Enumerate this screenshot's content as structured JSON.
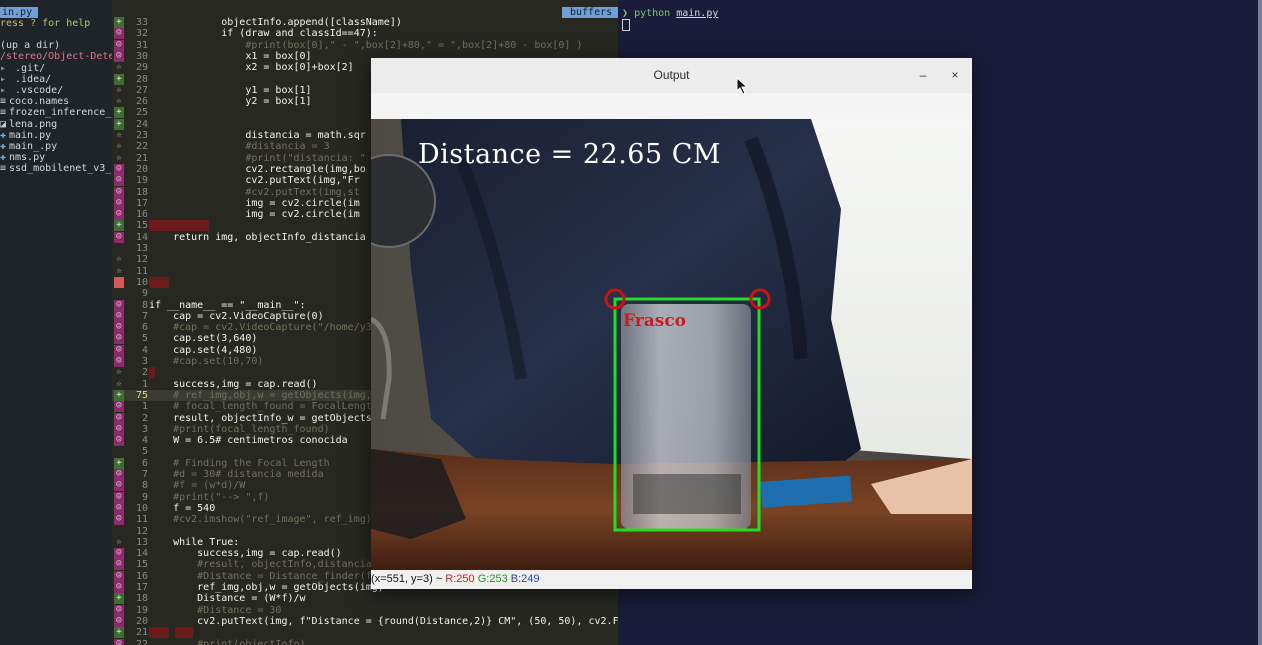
{
  "file_tree": {
    "tab": "in.py",
    "help": "ress ? for help",
    "entries": [
      {
        "icon": "",
        "text": ""
      },
      {
        "icon": "",
        "text": "(up a dir)"
      },
      {
        "icon": "",
        "text": "/stereo/Object-Dete"
      },
      {
        "icon": "folder",
        "text": " .git/"
      },
      {
        "icon": "folder",
        "text": " .idea/"
      },
      {
        "icon": "folder",
        "text": " .vscode/"
      },
      {
        "icon": "file",
        "text": "coco.names"
      },
      {
        "icon": "file",
        "text": "frozen_inference_"
      },
      {
        "icon": "image",
        "text": "lena.png"
      },
      {
        "icon": "python",
        "text": "main.py"
      },
      {
        "icon": "python",
        "text": "main_.py"
      },
      {
        "icon": "python",
        "text": "nms.py"
      },
      {
        "icon": "file",
        "text": "ssd_mobilenet_v3_"
      }
    ]
  },
  "editor": {
    "lines": [
      {
        "sign": "+",
        "num": "33",
        "code": "            objectInfo.append([className])"
      },
      {
        "sign": "demon",
        "num": "32",
        "code": "            if (draw and classId==47):"
      },
      {
        "sign": "demon",
        "num": "31",
        "code": "                #print(box[0],\" - \",box[2]+80,\" = \",box[2]+80 - box[0] )"
      },
      {
        "sign": "demon",
        "num": "30",
        "code": "                x1 = box[0]"
      },
      {
        "sign": "star",
        "num": "29",
        "code": "                x2 = box[0]+box[2]"
      },
      {
        "sign": "+",
        "num": "28",
        "code": ""
      },
      {
        "sign": "star",
        "num": "27",
        "code": "                y1 = box[1]"
      },
      {
        "sign": "star",
        "num": "26",
        "code": "                y2 = box[1]"
      },
      {
        "sign": "+",
        "num": "25",
        "code": ""
      },
      {
        "sign": "+",
        "num": "24",
        "code": ""
      },
      {
        "sign": "star",
        "num": "23",
        "code": "                distancia = math.sqr"
      },
      {
        "sign": "star",
        "num": "22",
        "code": "                #distancia = 3"
      },
      {
        "sign": "star",
        "num": "21",
        "code": "                #print(\"distancia: \""
      },
      {
        "sign": "demon",
        "num": "20",
        "code": "                cv2.rectangle(img,bo"
      },
      {
        "sign": "demon",
        "num": "19",
        "code": "                cv2.putText(img,\"Fr"
      },
      {
        "sign": "demon",
        "num": "18",
        "code": "                #cv2.putText(img,st"
      },
      {
        "sign": "demon",
        "num": "17",
        "code": "                img = cv2.circle(im"
      },
      {
        "sign": "demon",
        "num": "16",
        "code": "                img = cv2.circle(im"
      },
      {
        "sign": "+",
        "num": "15",
        "code": ""
      },
      {
        "sign": "demon",
        "num": "14",
        "code": "    return img, objectInfo_distancia"
      },
      {
        "sign": "",
        "num": "13",
        "code": ""
      },
      {
        "sign": "star",
        "num": "12",
        "code": ""
      },
      {
        "sign": "star",
        "num": "11",
        "code": ""
      },
      {
        "sign": "red",
        "num": "10",
        "code": ""
      },
      {
        "sign": "",
        "num": "9",
        "code": ""
      },
      {
        "sign": "demon",
        "num": "8",
        "code": "if __name__ == \"__main__\":"
      },
      {
        "sign": "demon",
        "num": "7",
        "code": "    cap = cv2.VideoCapture(0)"
      },
      {
        "sign": "demon",
        "num": "6",
        "code": "    #cap = cv2.VideoCapture(\"/home/y3rs"
      },
      {
        "sign": "demon",
        "num": "5",
        "code": "    cap.set(3,640)"
      },
      {
        "sign": "demon",
        "num": "4",
        "code": "    cap.set(4,480)"
      },
      {
        "sign": "demon",
        "num": "3",
        "code": "    #cap.set(10,70)"
      },
      {
        "sign": "star",
        "num": "2",
        "code": ""
      },
      {
        "sign": "star",
        "num": "1",
        "code": "    success,img = cap.read()"
      },
      {
        "sign": "+",
        "num": "75",
        "code": "    # ref_img,obj,w = getObjects(img, 0"
      },
      {
        "sign": "demon",
        "num": "1",
        "code": "    # focal_length_found = FocalLength("
      },
      {
        "sign": "demon",
        "num": "2",
        "code": "    result, objectInfo_w = getObjects(im"
      },
      {
        "sign": "demon",
        "num": "3",
        "code": "    #print(focal_length_found)"
      },
      {
        "sign": "demon",
        "num": "4",
        "code": "    W = 6.5# centimetros conocida"
      },
      {
        "sign": "",
        "num": "5",
        "code": ""
      },
      {
        "sign": "+",
        "num": "6",
        "code": "    # Finding the Focal Length"
      },
      {
        "sign": "demon",
        "num": "7",
        "code": "    #d = 30# distancia medida"
      },
      {
        "sign": "demon",
        "num": "8",
        "code": "    #f = (w*d)/W"
      },
      {
        "sign": "demon",
        "num": "9",
        "code": "    #print(\"--> \",f)"
      },
      {
        "sign": "demon",
        "num": "10",
        "code": "    f = 540"
      },
      {
        "sign": "demon",
        "num": "11",
        "code": "    #cv2.imshow(\"ref_image\", ref_img)"
      },
      {
        "sign": "",
        "num": "12",
        "code": ""
      },
      {
        "sign": "star",
        "num": "13",
        "code": "    while True:"
      },
      {
        "sign": "demon",
        "num": "14",
        "code": "        success,img = cap.read()"
      },
      {
        "sign": "demon",
        "num": "15",
        "code": "        #result, objectInfo,distancia ="
      },
      {
        "sign": "demon",
        "num": "16",
        "code": "        #Distance = Distance_finder(foc"
      },
      {
        "sign": "demon",
        "num": "17",
        "code": "        ref_img,obj,w = getObjects(img,"
      },
      {
        "sign": "+",
        "num": "18",
        "code": "        Distance = (W*f)/w"
      },
      {
        "sign": "demon",
        "num": "19",
        "code": "        #Distance = 30"
      },
      {
        "sign": "demon",
        "num": "20",
        "code": "        cv2.putText(img, f\"Distance = {round(Distance,2)} CM\", (50, 50), cv2.FONT_H"
      },
      {
        "sign": "+",
        "num": "21",
        "code": ""
      },
      {
        "sign": "demon",
        "num": "22",
        "code": "        #print(objectInfo)"
      }
    ]
  },
  "terminal": {
    "buffers_label": "buffers",
    "prompt_arrow": "❯",
    "command": "python",
    "file": "main.py"
  },
  "output_window": {
    "title": "Output",
    "minimize_glyph": "–",
    "close_glyph": "×",
    "distance_text": "Distance = 22.65 CM",
    "object_label": "Frasco",
    "status": {
      "coords": "(x=551, y=3) ~ ",
      "r": "R:250",
      "g": "G:253",
      "b": "B:249"
    },
    "colors": {
      "box": "#22dd22",
      "circle": "#cc1111",
      "label": "#d11717",
      "r_text": "#d41d1d",
      "g_text": "#1a9a1a",
      "b_text": "#2040c8"
    }
  }
}
